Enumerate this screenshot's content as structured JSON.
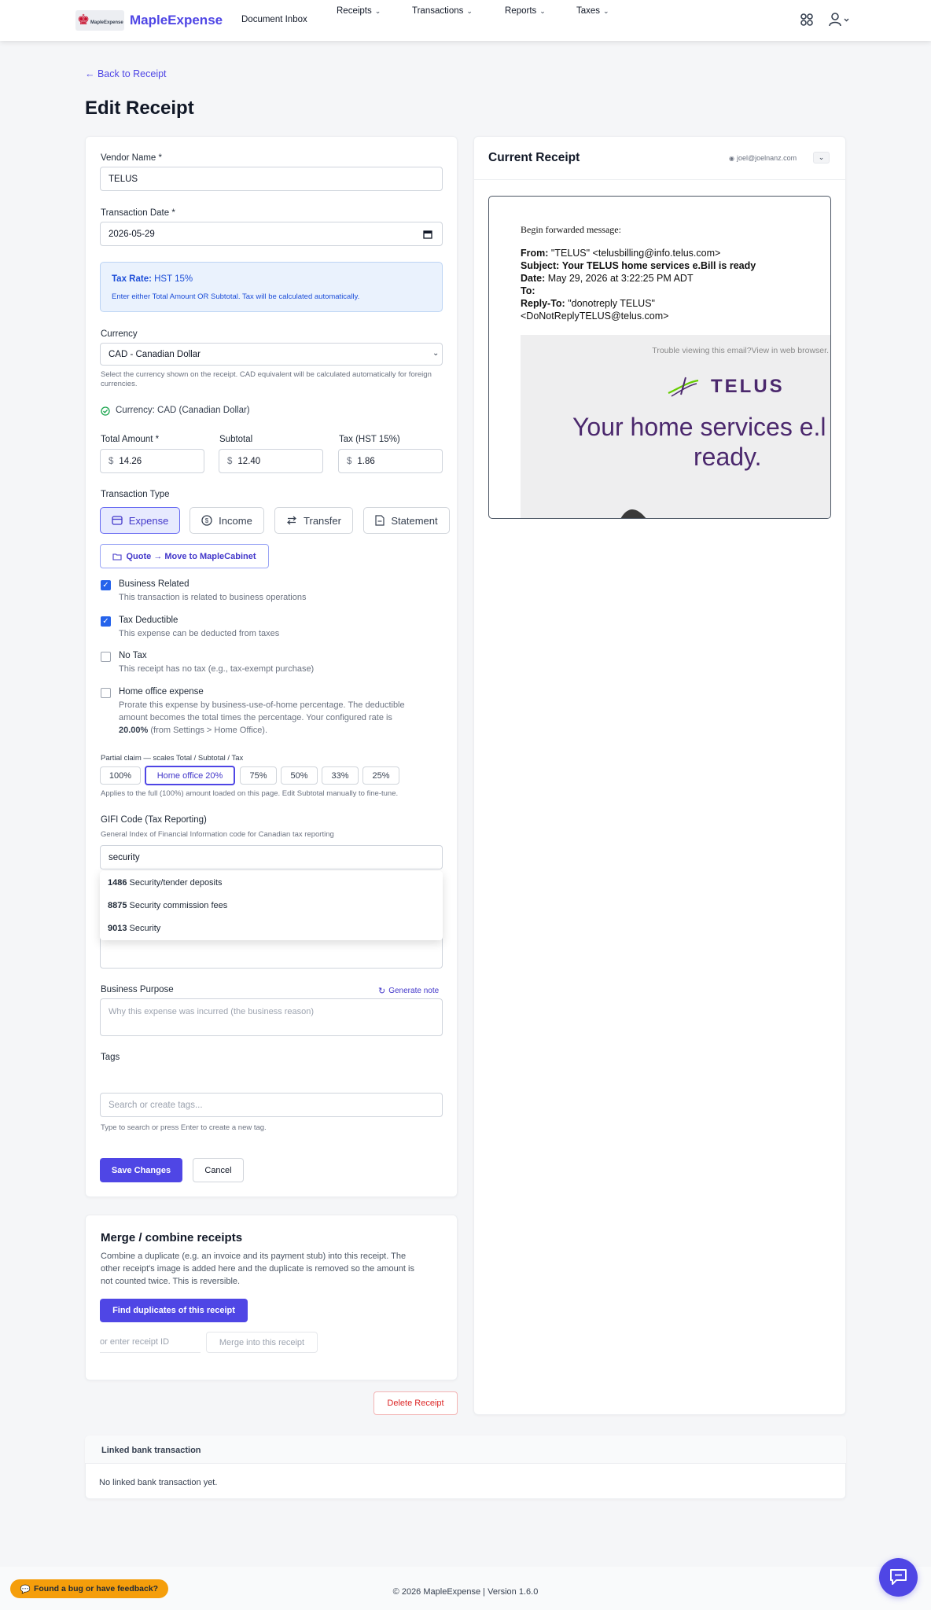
{
  "nav": {
    "brand": "MapleExpense",
    "logo_text": "MapleExpense",
    "document_inbox": "Document Inbox",
    "receipts": "Receipts",
    "transactions": "Transactions",
    "reports": "Reports",
    "taxes": "Taxes"
  },
  "page": {
    "back_link": "← Back to Receipt",
    "title": "Edit Receipt"
  },
  "form": {
    "vendor_label": "Vendor Name *",
    "vendor_value": "TELUS",
    "date_label": "Transaction Date *",
    "date_value": "2026-05-29",
    "tax_rate_label": "Tax Rate:",
    "tax_rate_value": "HST 15%",
    "tax_rate_help": "Enter either Total Amount OR Subtotal. Tax will be calculated automatically.",
    "currency_label": "Currency",
    "currency_value": "CAD - Canadian Dollar",
    "currency_help": "Select the currency shown on the receipt. CAD equivalent will be calculated automatically for foreign currencies.",
    "currency_status": "Currency: CAD (Canadian Dollar)",
    "total_label": "Total Amount *",
    "total_value": "14.26",
    "subtotal_label": "Subtotal",
    "subtotal_value": "12.40",
    "tax_label": "Tax (HST 15%)",
    "tax_value": "1.86",
    "currency_symbol": "$",
    "type_label": "Transaction Type",
    "types": [
      "Expense",
      "Income",
      "Transfer",
      "Statement"
    ],
    "quote_button": "Quote → Move to MapleCabinet",
    "business_title": "Business Related",
    "business_desc": "This transaction is related to business operations",
    "deductible_title": "Tax Deductible",
    "deductible_desc": "This expense can be deducted from taxes",
    "notax_title": "No Tax",
    "notax_desc": "This receipt has no tax (e.g., tax-exempt purchase)",
    "home_title": "Home office expense",
    "home_desc_1": "Prorate this expense by business-use-of-home percentage. The deductible",
    "home_desc_2": "amount becomes the total times the percentage. Your configured rate is",
    "home_rate": "20.00%",
    "home_desc_3": "(from Settings > Home Office).",
    "partial_label": "Partial claim — scales Total / Subtotal / Tax",
    "partial_options": [
      "100%",
      "Home office 20%",
      "75%",
      "50%",
      "33%",
      "25%"
    ],
    "partial_help": "Applies to the full (100%) amount loaded on this page. Edit Subtotal manually to fine-tune.",
    "gifi_label": "GIFI Code (Tax Reporting)",
    "gifi_help": "General Index of Financial Information code for Canadian tax reporting",
    "gifi_value": "security",
    "gifi_options": [
      {
        "code": "1486",
        "name": "Security/tender deposits"
      },
      {
        "code": "8875",
        "name": "Security commission fees"
      },
      {
        "code": "9013",
        "name": "Security"
      }
    ],
    "purpose_label": "Business Purpose",
    "generate_note": "Generate note",
    "purpose_placeholder": "Why this expense was incurred (the business reason)",
    "tags_label": "Tags",
    "tags_placeholder": "Search or create tags...",
    "tags_help": "Type to search or press Enter to create a new tag.",
    "save": "Save Changes",
    "cancel": "Cancel"
  },
  "merge": {
    "title": "Merge / combine receipts",
    "desc_1": "Combine a duplicate (e.g. an invoice and its payment stub) into this receipt. The",
    "desc_2": "other receipt's image is added here and the duplicate is removed so the amount is",
    "desc_3": "not counted twice. This is reversible.",
    "find_button": "Find duplicates of this receipt",
    "id_placeholder": "or enter receipt ID",
    "merge_button": "Merge into this receipt"
  },
  "delete_button": "Delete Receipt",
  "receipt_panel": {
    "title": "Current Receipt",
    "email_chip": "joel@joelnanz.com",
    "fwd": "Begin forwarded message:",
    "from_label": "From:",
    "from_value": "\"TELUS\" <telusbilling@info.telus.com>",
    "subject_label": "Subject:",
    "subject_value": "Your TELUS home services e.Bill is ready",
    "date_label": "Date:",
    "date_value": "May 29, 2026 at 3:22:25 PM ADT",
    "to_label": "To:",
    "replyto_label": "Reply-To:",
    "replyto_value": "\"donotreply TELUS\"",
    "replyto_value_2": "<DoNotReplyTELUS@telus.com>",
    "trouble": "Trouble viewing this email?View in web browser.",
    "telus_logo": "TELUS",
    "headline_1": "Your home services e.l",
    "headline_2": "ready."
  },
  "linked": {
    "title": "Linked bank transaction",
    "empty": "No linked bank transaction yet."
  },
  "footer": {
    "copyright": "© 2026 MapleExpense | Version 1.6.0",
    "feedback": "Found a bug or have feedback?"
  },
  "colors": {
    "primary": "#4f46e5",
    "danger": "#dc2626",
    "feedback": "#f59e0b"
  }
}
